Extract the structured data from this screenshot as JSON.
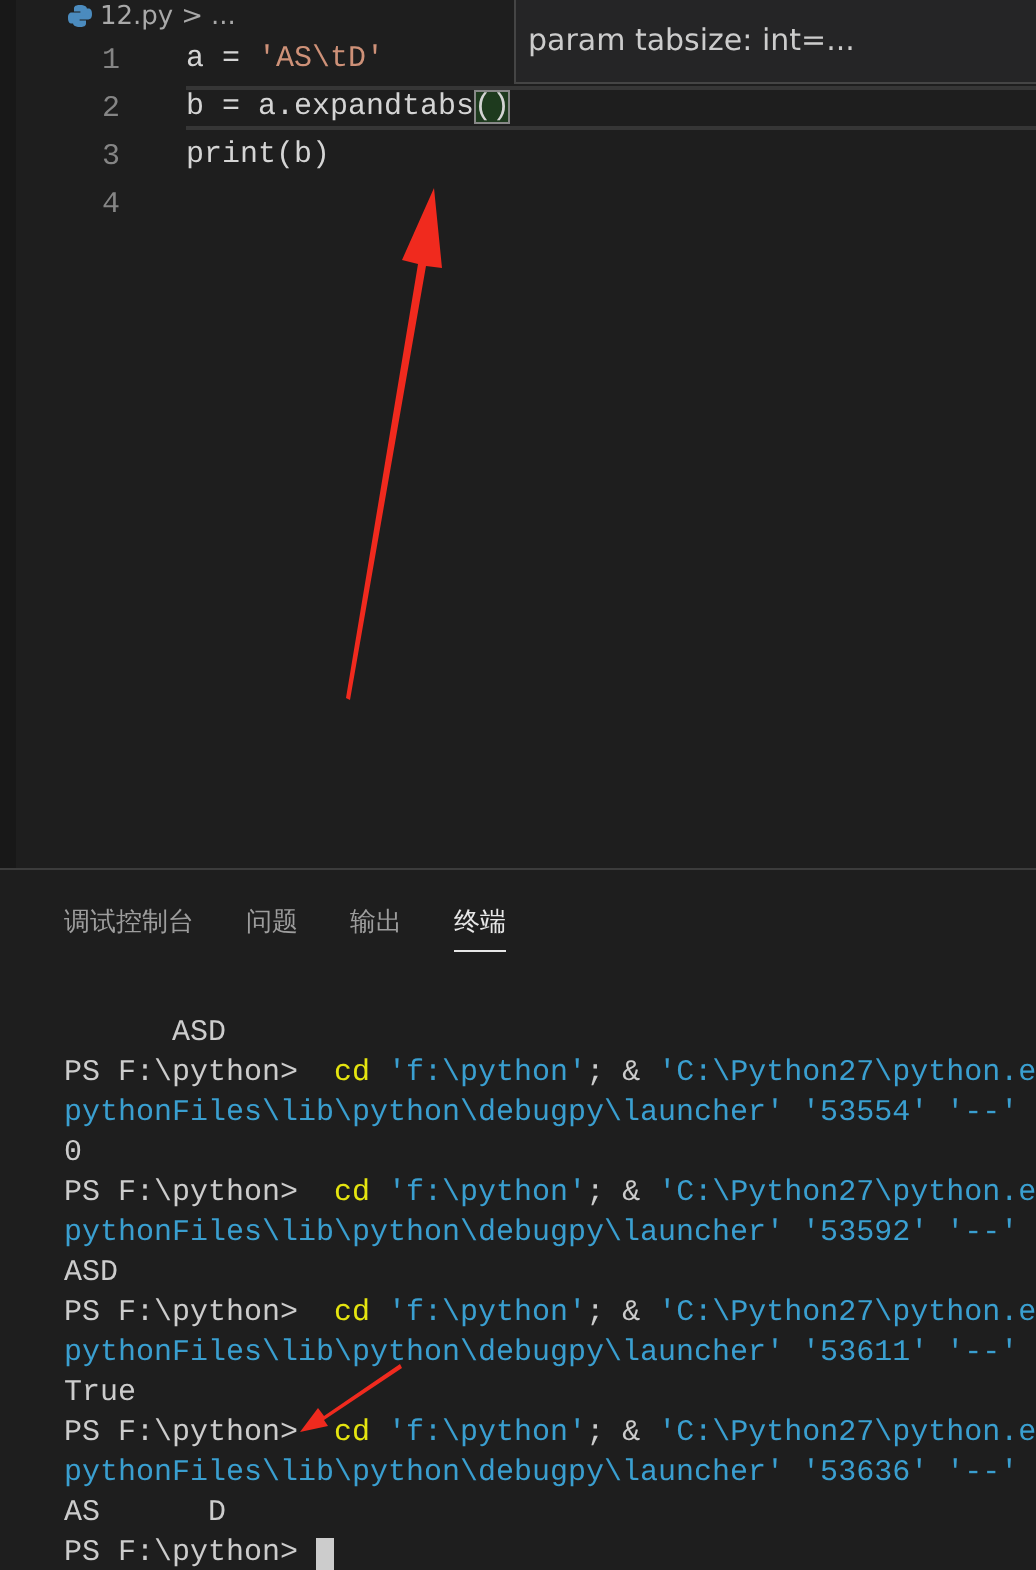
{
  "editor": {
    "breadcrumb": {
      "file": "12.py",
      "separator": ">",
      "rest": "..."
    },
    "lines": [
      {
        "number": "1",
        "current": false,
        "tokens": [
          {
            "text": "a = ",
            "kind": "plain"
          },
          {
            "text": "'AS\\tD'",
            "kind": "string"
          }
        ]
      },
      {
        "number": "2",
        "current": true,
        "tokens": [
          {
            "text": "b = a.expandtabs",
            "kind": "plain"
          },
          {
            "text": "()",
            "kind": "matched"
          }
        ]
      },
      {
        "number": "3",
        "current": false,
        "tokens": [
          {
            "text": "print(b)",
            "kind": "plain"
          }
        ]
      },
      {
        "number": "4",
        "current": false
      }
    ],
    "hover": {
      "text": "param tabsize: int=..."
    }
  },
  "panel": {
    "tabs": [
      {
        "label": "调试控制台",
        "selected": false
      },
      {
        "label": "问题",
        "selected": false
      },
      {
        "label": "输出",
        "selected": false
      },
      {
        "label": "终端",
        "selected": true
      }
    ]
  },
  "terminal": {
    "lines": [
      [
        {
          "text": "      ASD",
          "kind": "plain"
        }
      ],
      [
        {
          "text": "PS F:\\python>  ",
          "kind": "plain"
        },
        {
          "text": "cd",
          "kind": "command"
        },
        {
          "text": " 'f:\\python'",
          "kind": "string"
        },
        {
          "text": "; & ",
          "kind": "plain"
        },
        {
          "text": "'C:\\Python27\\python.e",
          "kind": "string"
        }
      ],
      [
        {
          "text": "pythonFiles\\lib\\python\\debugpy\\launcher' '53554' '--'",
          "kind": "string"
        }
      ],
      [
        {
          "text": "0",
          "kind": "plain"
        }
      ],
      [
        {
          "text": "PS F:\\python>  ",
          "kind": "plain"
        },
        {
          "text": "cd",
          "kind": "command"
        },
        {
          "text": " 'f:\\python'",
          "kind": "string"
        },
        {
          "text": "; & ",
          "kind": "plain"
        },
        {
          "text": "'C:\\Python27\\python.e",
          "kind": "string"
        }
      ],
      [
        {
          "text": "pythonFiles\\lib\\python\\debugpy\\launcher' '53592' '--'",
          "kind": "string"
        }
      ],
      [
        {
          "text": "ASD",
          "kind": "plain"
        }
      ],
      [
        {
          "text": "PS F:\\python>  ",
          "kind": "plain"
        },
        {
          "text": "cd",
          "kind": "command"
        },
        {
          "text": " 'f:\\python'",
          "kind": "string"
        },
        {
          "text": "; & ",
          "kind": "plain"
        },
        {
          "text": "'C:\\Python27\\python.e",
          "kind": "string"
        }
      ],
      [
        {
          "text": "pythonFiles\\lib\\python\\debugpy\\launcher' '53611' '--'",
          "kind": "string"
        }
      ],
      [
        {
          "text": "True",
          "kind": "plain"
        }
      ],
      [
        {
          "text": "PS F:\\python>  ",
          "kind": "plain"
        },
        {
          "text": "cd",
          "kind": "command"
        },
        {
          "text": " 'f:\\python'",
          "kind": "string"
        },
        {
          "text": "; & ",
          "kind": "plain"
        },
        {
          "text": "'C:\\Python27\\python.e",
          "kind": "string"
        }
      ],
      [
        {
          "text": "pythonFiles\\lib\\python\\debugpy\\launcher' '53636' '--'",
          "kind": "string"
        }
      ],
      [
        {
          "text": "AS      D",
          "kind": "plain"
        }
      ],
      [
        {
          "text": "PS F:\\python> ",
          "kind": "plain"
        }
      ]
    ],
    "cursor": true
  }
}
